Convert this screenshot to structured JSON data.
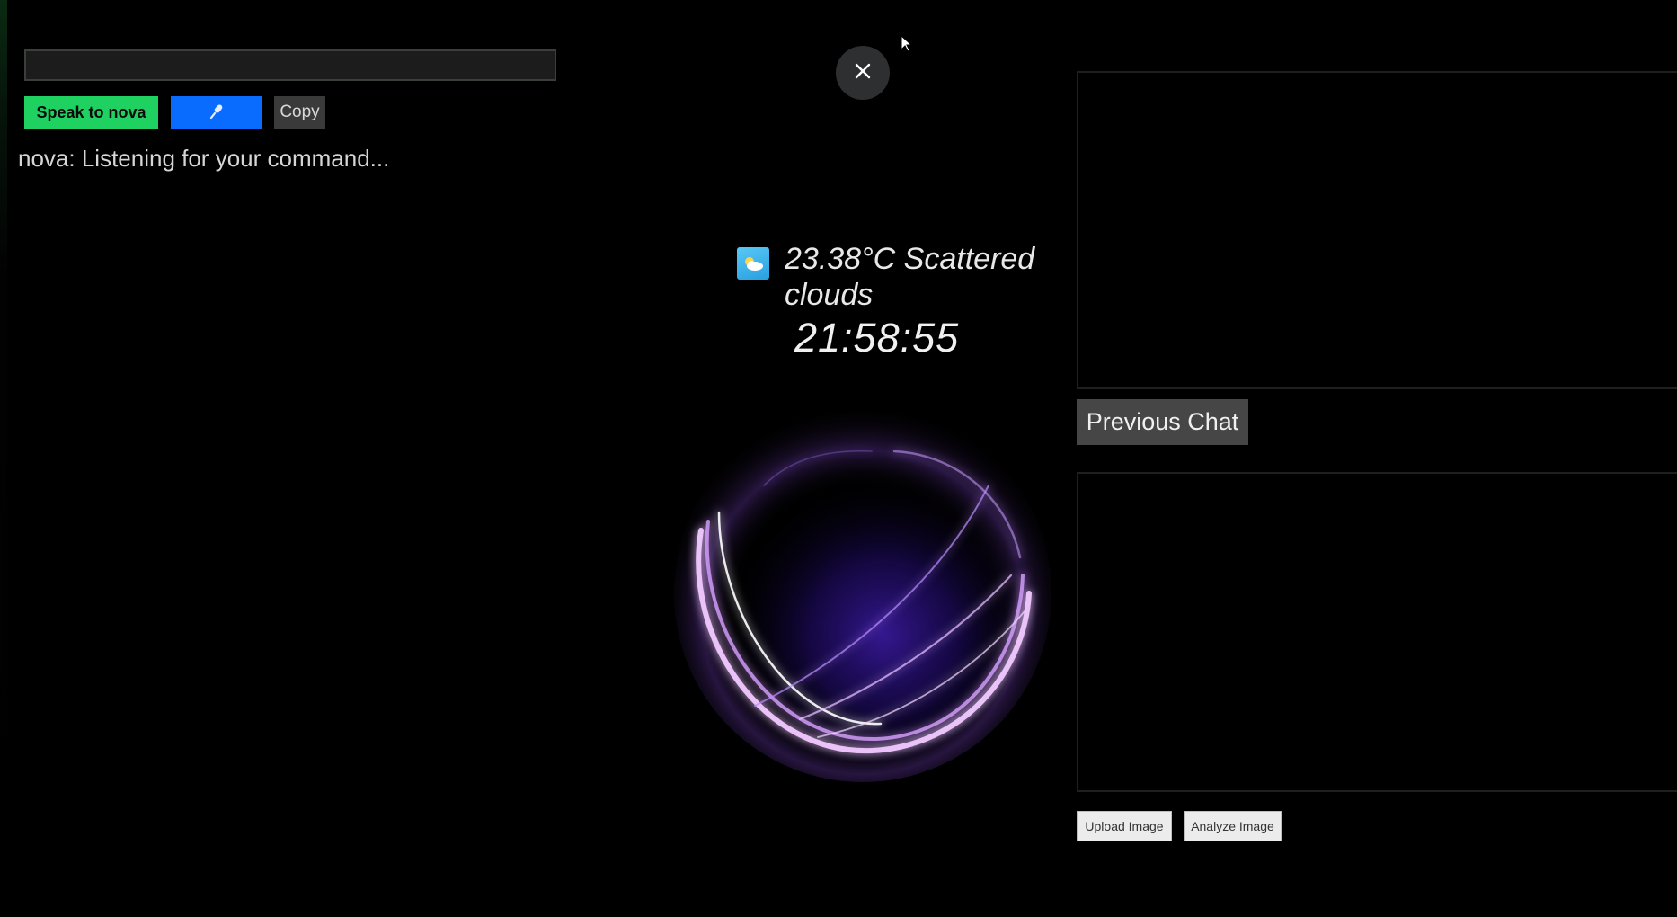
{
  "command": {
    "input_value": "",
    "speak_button_label": "Speak to nova",
    "mic_button_icon": "microphone-icon",
    "copy_button_label": "Copy",
    "status_text": "nova: Listening for your command..."
  },
  "overlay": {
    "close_icon": "close-icon"
  },
  "weather": {
    "icon": "weather-cloud-icon",
    "text": "23.38°C Scattered clouds"
  },
  "clock": {
    "time": "21:58:55"
  },
  "right_panel": {
    "previous_chat_label": "Previous Chat",
    "upload_image_label": "Upload Image",
    "analyze_image_label": "Analyze Image"
  },
  "colors": {
    "speak_button": "#1fd160",
    "mic_button": "#0a6cff",
    "orb_glow": "#b070ff",
    "background": "#000000"
  }
}
